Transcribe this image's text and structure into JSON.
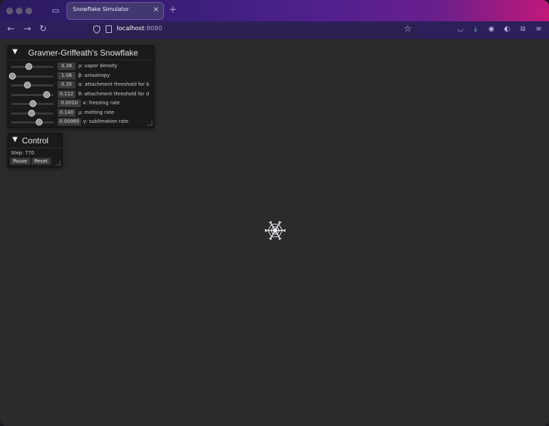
{
  "browser": {
    "tab_title": "Snowflake Simulator",
    "tab_close": "×",
    "new_tab": "+",
    "url_host": "localhost",
    "url_port": ":8080",
    "star": "☆"
  },
  "panel_main": {
    "title": "Gravner-Griffeath's Snowflake",
    "params": [
      {
        "value": "0.38",
        "label": "ρ: vapor density",
        "pos": 0.41
      },
      {
        "value": "1.06",
        "label": "β: anisotropy",
        "pos": 0.0
      },
      {
        "value": "0.35",
        "label": "α: attachment threshold for b",
        "pos": 0.38
      },
      {
        "value": "0.112",
        "label": "θ: attachment threshold for d",
        "pos": 0.86
      },
      {
        "value": "0.0010",
        "label": "κ: freezing rate",
        "pos": 0.51
      },
      {
        "value": "0.140",
        "label": "μ: melting rate",
        "pos": 0.48
      },
      {
        "value": "0.00060",
        "label": "γ: sublimation rate",
        "pos": 0.68
      }
    ]
  },
  "panel_control": {
    "title": "Control",
    "step": "Step: 770",
    "pause_label": "Pause",
    "reset_label": "Reset"
  },
  "colors": {
    "accent_gradient_start": "#2a1a5e",
    "accent_gradient_end": "#c2187a",
    "canvas_bg": "#2b2b2c",
    "snowflake": "#e8e8ee"
  }
}
